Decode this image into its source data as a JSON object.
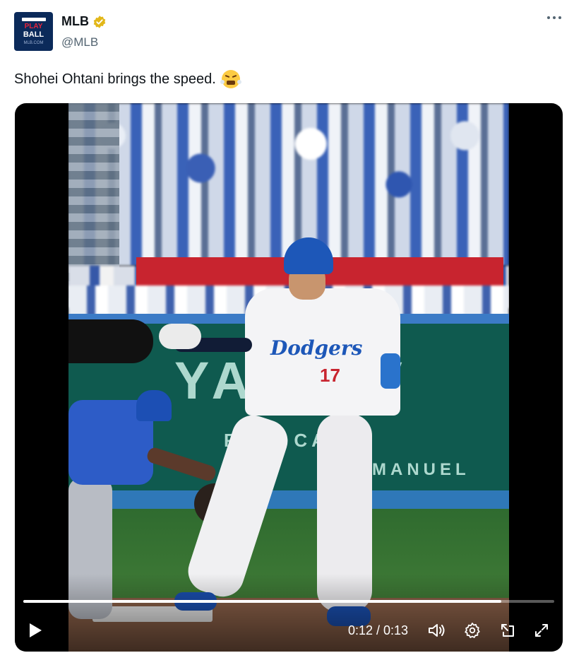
{
  "author": {
    "display_name": "MLB",
    "handle": "@MLB",
    "avatar": {
      "line1": "PLAY",
      "line2": "BALL",
      "line3": "MLB.COM"
    }
  },
  "tweet": {
    "text": "Shohei Ohtani brings the speed.",
    "emoji": "face-with-steam-from-nose"
  },
  "video": {
    "scene_text": {
      "wall_big": "YA  MAV",
      "wall_mid": "RE  &  CASIN",
      "wall_small": "MANUEL",
      "jersey_logo": "Dodgers",
      "jersey_number": "17"
    },
    "time_display": "0:12 / 0:13",
    "progress_fraction": 0.9
  },
  "colors": {
    "text_primary": "#0f1419",
    "text_secondary": "#536471",
    "verified_gold": "#e2b719"
  },
  "icons": {
    "more": "more-horizontal-icon",
    "play": "play-icon",
    "volume": "volume-icon",
    "settings": "gear-icon",
    "popout": "pop-out-icon",
    "fullscreen": "fullscreen-icon"
  }
}
